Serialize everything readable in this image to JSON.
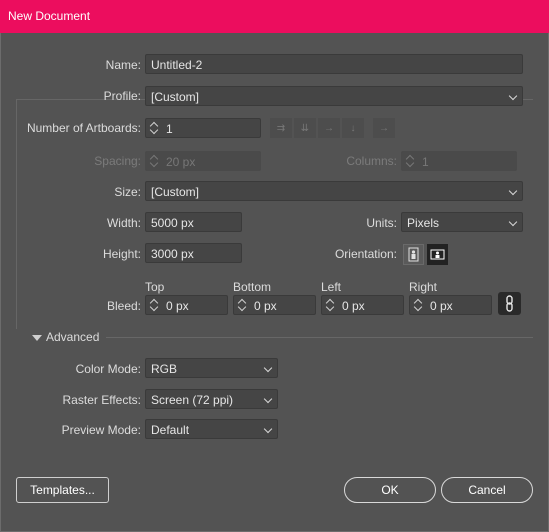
{
  "window": {
    "title": "New Document"
  },
  "name": {
    "label": "Name:",
    "value": "Untitled-2"
  },
  "profile": {
    "label": "Profile:",
    "value": "[Custom]"
  },
  "artboards": {
    "label": "Number of Artboards:",
    "value": "1"
  },
  "spacing": {
    "label": "Spacing:",
    "value": "20 px"
  },
  "columns": {
    "label": "Columns:",
    "value": "1"
  },
  "size": {
    "label": "Size:",
    "value": "[Custom]"
  },
  "width": {
    "label": "Width:",
    "value": "5000 px"
  },
  "height": {
    "label": "Height:",
    "value": "3000 px"
  },
  "units": {
    "label": "Units:",
    "value": "Pixels"
  },
  "orientation": {
    "label": "Orientation:",
    "selected": "landscape"
  },
  "bleed": {
    "label": "Bleed:",
    "top": {
      "label": "Top",
      "value": "0 px"
    },
    "bottom": {
      "label": "Bottom",
      "value": "0 px"
    },
    "left": {
      "label": "Left",
      "value": "0 px"
    },
    "right": {
      "label": "Right",
      "value": "0 px"
    }
  },
  "advanced": {
    "label": "Advanced",
    "color_mode": {
      "label": "Color Mode:",
      "value": "RGB"
    },
    "raster_effects": {
      "label": "Raster Effects:",
      "value": "Screen (72 ppi)"
    },
    "preview_mode": {
      "label": "Preview Mode:",
      "value": "Default"
    }
  },
  "buttons": {
    "templates": "Templates...",
    "ok": "OK",
    "cancel": "Cancel"
  },
  "colors": {
    "titlebar": "#ec0d5e",
    "background": "#535353",
    "field": "#454545"
  }
}
